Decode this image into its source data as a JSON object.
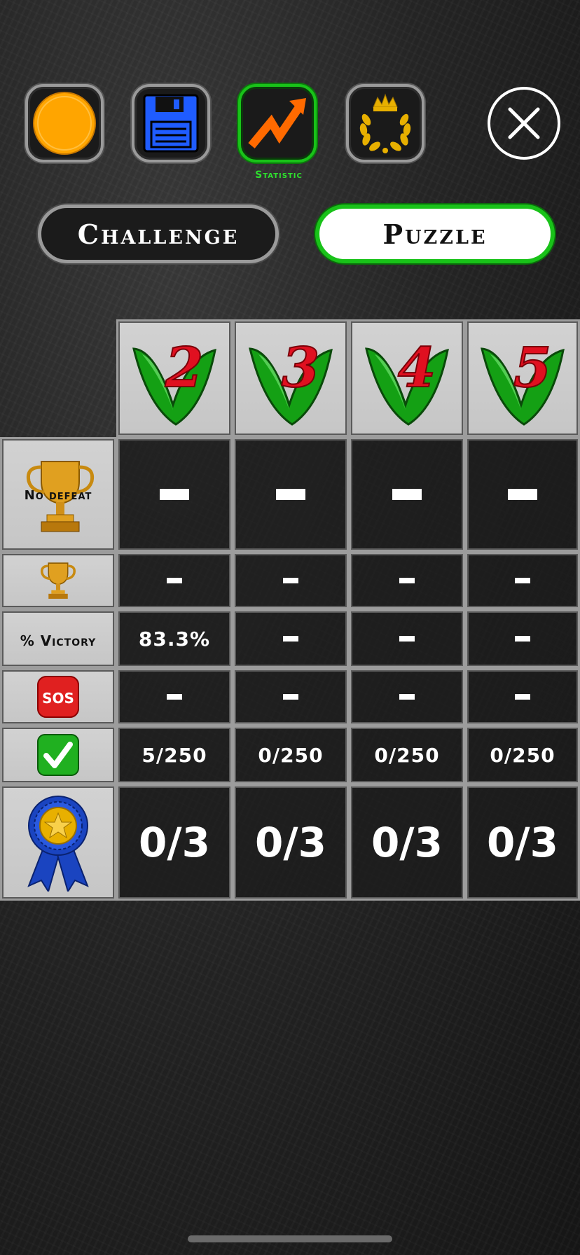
{
  "header": {
    "active_tab_label": "Statistic",
    "icons": [
      "coin-icon",
      "floppy-disk-icon",
      "trend-arrow-icon",
      "laurel-crown-icon"
    ],
    "close_icon": "close-icon"
  },
  "modes": {
    "challenge_label": "Challenge",
    "puzzle_label": "Puzzle",
    "selected": "Puzzle"
  },
  "table": {
    "columns": [
      "2",
      "3",
      "4",
      "5"
    ],
    "rows": [
      {
        "id": "no-defeat",
        "label": "No defeat",
        "icon": "big-trophy-icon",
        "values": [
          "-",
          "-",
          "-",
          "-"
        ]
      },
      {
        "id": "trophy",
        "label": "",
        "icon": "small-trophy-icon",
        "values": [
          "-",
          "-",
          "-",
          "-"
        ]
      },
      {
        "id": "victory",
        "label": "% Victory",
        "icon": "",
        "values": [
          "83.3%",
          "-",
          "-",
          "-"
        ]
      },
      {
        "id": "sos",
        "label": "SOS",
        "icon": "sos-icon",
        "values": [
          "-",
          "-",
          "-",
          "-"
        ]
      },
      {
        "id": "solved",
        "label": "",
        "icon": "check-icon",
        "values": [
          "5/250",
          "0/250",
          "0/250",
          "0/250"
        ]
      },
      {
        "id": "ribbon",
        "label": "",
        "icon": "ribbon-medal-icon",
        "values": [
          "0/3",
          "0/3",
          "0/3",
          "0/3"
        ]
      }
    ]
  },
  "colors": {
    "accent_green": "#19c219",
    "frame_gray": "#9c9c9c",
    "coin_orange": "#ffa500",
    "number_red": "#e01020"
  }
}
